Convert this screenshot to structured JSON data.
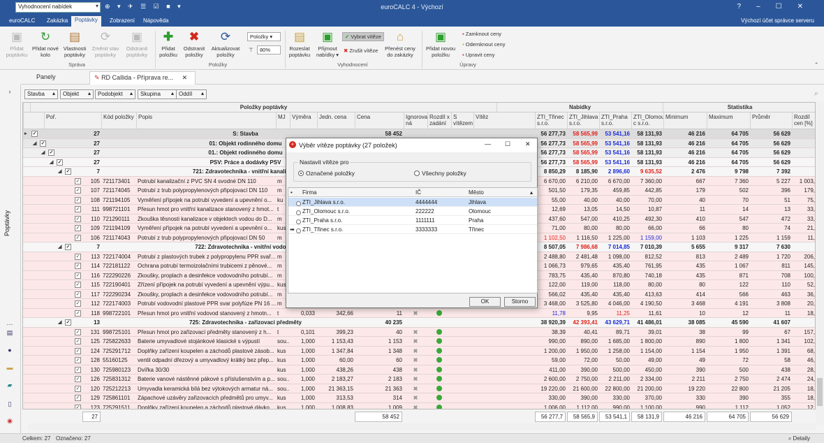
{
  "titlebar": {
    "combo_value": "Vyhodnocení nabídek",
    "title": "euroCALC 4 - Výchozí",
    "help": "?",
    "minimize": "–",
    "maximize": "☐",
    "close": "✕"
  },
  "ribbon_tabs": [
    "euroCALC",
    "Zakázka",
    "Poptávky",
    "Zobrazení",
    "Nápověda"
  ],
  "account": "Výchozí účet správce serveru",
  "ribbon": {
    "sprava": {
      "label": "Správa",
      "buttons": [
        "Přidat poptávku",
        "Přidat nové kolo",
        "Vlastnosti poptávky",
        "Změnit stav poptávky",
        "Odstranit poptávky"
      ]
    },
    "polozky": {
      "label": "Položky",
      "buttons": [
        "Přidat položku",
        "Odstranit položky",
        "Aktualizovat položky"
      ],
      "combo": "Položky",
      "zoom": "80%"
    },
    "vyhodnoceni": {
      "label": "Vyhodnocení",
      "buttons": [
        "Rozeslat poptávku",
        "Přijmout nabídky ▾",
        "Vybrat vítěze",
        "Zrušit vítěze",
        "Přenést ceny do zakázky"
      ]
    },
    "upravy": {
      "label": "Úpravy",
      "buttons": [
        "Přidat novou položku",
        "Zamknout ceny",
        "Odemknout ceny",
        "Upravit ceny"
      ]
    }
  },
  "panels_tab": "Panely",
  "doc_tab": "RD Callida - Příprava re...",
  "sidebar_label": "Poptávky",
  "filters": [
    "Stavba",
    "Objekt",
    "Podobjekt",
    "Skupina",
    "Oddíl"
  ],
  "header_groups": {
    "items": "Položky poptávky",
    "offers": "Nabídky",
    "stats": "Statistika"
  },
  "columns": [
    "Poř.",
    "Kód položky",
    "Popis",
    "MJ",
    "Výměra",
    "Jedn. cena",
    "Cena",
    "Ignorova ná",
    "Rozdíl x zadání",
    "S vítězem",
    "Vítěz",
    "ZTI_Třinec s.r.o.",
    "ZTI_Jihlava s.r.o.",
    "ZTI_Praha s.r.o.",
    "ZTI_Olomou c s.r.o.",
    "Minimum",
    "Maximum",
    "Průměr",
    "Rozdíl cen [%]"
  ],
  "rows": [
    {
      "k": "g0",
      "lvl": 0,
      "por": "27",
      "popis": "S: Stavba",
      "cena": "58 452",
      "t": "56 277,73",
      "j": "58 565,99",
      "p": "53 541,16",
      "o": "58 131,93",
      "min": "46 216",
      "max": "64 705",
      "avg": "56 629",
      "rz": ""
    },
    {
      "k": "g1",
      "lvl": 1,
      "por": "27",
      "popis": "01: Objekt rodinného domu",
      "cena": "",
      "t": "56 277,73",
      "j": "58 565,99",
      "p": "53 541,16",
      "o": "58 131,93",
      "min": "46 216",
      "max": "64 705",
      "avg": "56 629",
      "rz": ""
    },
    {
      "k": "g2",
      "lvl": 2,
      "por": "27",
      "popis": "01.: Objekt rodinného domu",
      "cena": "",
      "t": "56 277,73",
      "j": "58 565,99",
      "p": "53 541,16",
      "o": "58 131,93",
      "min": "46 216",
      "max": "64 705",
      "avg": "56 629",
      "rz": ""
    },
    {
      "k": "g3",
      "lvl": 3,
      "por": "27",
      "popis": "PSV: Práce a dodávky PSV",
      "cena": "",
      "t": "56 277,73",
      "j": "58 565,99",
      "p": "53 541,16",
      "o": "58 131,93",
      "min": "46 216",
      "max": "64 705",
      "avg": "56 629",
      "rz": ""
    },
    {
      "k": "g3",
      "lvl": 4,
      "por": "7",
      "popis": "721: Zdravotechnika - vnitřní kanalizace",
      "cena": "",
      "t": "8 850,29",
      "j": "8 185,90",
      "p": "2 896,60",
      "o": "9 635,52",
      "min": "2 476",
      "max": "9 798",
      "avg": "7 392",
      "rz": ""
    },
    {
      "k": "item",
      "por": "105",
      "kod": "721173401",
      "popis": "Potrubí kanalizační z PVC SN 4 svodné DN 110",
      "mj": "m",
      "t": "6 670,00",
      "j": "6 210,00",
      "p": "6 670,00",
      "o": "7 360,00",
      "min": "667",
      "max": "7 360",
      "avg": "5 227",
      "rz": "1 003,"
    },
    {
      "k": "item",
      "por": "107",
      "kod": "721174045",
      "popis": "Potrubí z trub polypropylenových připojovací DN 110",
      "mj": "m",
      "t": "501,50",
      "j": "179,35",
      "p": "459,85",
      "o": "442,85",
      "min": "179",
      "max": "502",
      "avg": "396",
      "rz": "179,"
    },
    {
      "k": "item",
      "por": "108",
      "kod": "721194105",
      "popis": "Vyměření přípojek na potrubí vyvedení a upevnění o...",
      "mj": "ku",
      "t": "55,00",
      "j": "40,00",
      "p": "40,00",
      "o": "70,00",
      "min": "40",
      "max": "70",
      "avg": "51",
      "rz": "75,"
    },
    {
      "k": "item",
      "por": "111",
      "kod": "998721101",
      "popis": "Přesun hmot pro vnitřní kanalizace stanovený z hmot...",
      "mj": "t",
      "t": "12,69",
      "j": "13,05",
      "p": "14,50",
      "o": "10,87",
      "min": "11",
      "max": "14",
      "avg": "13",
      "rz": "33,"
    },
    {
      "k": "item",
      "por": "110",
      "kod": "721290111",
      "popis": "Zkouška těsnosti kanalizace v objektech vodou do D...",
      "mj": "m",
      "t": "437,60",
      "j": "547,00",
      "p": "410,25",
      "o": "492,30",
      "min": "410",
      "max": "547",
      "avg": "472",
      "rz": "33,"
    },
    {
      "k": "item",
      "por": "109",
      "kod": "721194109",
      "popis": "Vyměření přípojek na potrubí vyvedení a upevnění o...",
      "mj": "kus",
      "t": "71,00",
      "j": "80,00",
      "p": "80,00",
      "o": "66,00",
      "min": "66",
      "max": "80",
      "avg": "74",
      "rz": "21,"
    },
    {
      "k": "item",
      "por": "106",
      "kod": "721174043",
      "popis": "Potrubí z trub polypropylenových připojovací DN 50",
      "mj": "m",
      "t": "1 102,50",
      "j": "1 116,50",
      "p": "1 225,00",
      "o": "1 159,00",
      "min": "1 103",
      "max": "1 225",
      "avg": "1 159",
      "rz": "11,"
    },
    {
      "k": "g3",
      "lvl": 4,
      "por": "7",
      "popis": "722: Zdravotechnika - vnitřní vodovod",
      "cena": "",
      "t": "8 507,05",
      "j": "7 986,68",
      "p": "7 014,85",
      "o": "7 010,39",
      "min": "5 655",
      "max": "9 317",
      "avg": "7 630",
      "rz": ""
    },
    {
      "k": "item",
      "por": "113",
      "kod": "722174004",
      "popis": "Potrubí z plastových trubek z polypropylenu PPR svař...",
      "mj": "m",
      "t": "2 488,80",
      "j": "2 481,48",
      "p": "1 098,00",
      "o": "812,52",
      "min": "813",
      "max": "2 489",
      "avg": "1 720",
      "rz": "206,"
    },
    {
      "k": "item",
      "por": "114",
      "kod": "722181122",
      "popis": "Ochrana potrubí termoizolačními trubicemi z pěnové...",
      "mj": "m",
      "t": "1 066,73",
      "j": "979,65",
      "p": "435,40",
      "o": "761,95",
      "min": "435",
      "max": "1 067",
      "avg": "811",
      "rz": "145,"
    },
    {
      "k": "item",
      "por": "116",
      "kod": "722290226",
      "popis": "Zkoušky, proplach a desinfekce vodovodního potrubí...",
      "mj": "m",
      "t": "783,75",
      "j": "435,40",
      "p": "870,80",
      "o": "740,18",
      "min": "435",
      "max": "871",
      "avg": "708",
      "rz": "100,"
    },
    {
      "k": "item",
      "por": "115",
      "kod": "722190401",
      "popis": "Zřízení přípojek na potrubí vyvedení a upevnění výpu...",
      "mj": "kus",
      "t": "122,00",
      "j": "119,00",
      "p": "118,00",
      "o": "80,00",
      "min": "80",
      "max": "122",
      "avg": "110",
      "rz": "52,"
    },
    {
      "k": "item",
      "por": "117",
      "kod": "722290234",
      "popis": "Zkoušky, proplach a desinfekce vodovodního potrubí...",
      "mj": "m",
      "t": "566,02",
      "j": "435,40",
      "p": "435,40",
      "o": "413,63",
      "min": "414",
      "max": "566",
      "avg": "463",
      "rz": "36,"
    },
    {
      "k": "item",
      "por": "112",
      "kod": "722174003",
      "popis": "Potrubí vodovodní plastové PPR svar polyfúze PN 16 ...",
      "mj": "m",
      "t": "3 468,00",
      "j": "3 525,80",
      "p": "4 046,00",
      "o": "4 190,50",
      "min": "3 468",
      "max": "4 191",
      "avg": "3 808",
      "rz": "20,"
    },
    {
      "k": "item",
      "por": "118",
      "kod": "998722101",
      "popis": "Přesun hmot pro vnitřní vodovod stanovený z hmotn...",
      "mj": "t",
      "vym": "0,033",
      "jc": "342,66",
      "cena": "11",
      "x": "✖",
      "dot": true,
      "t": "11,78",
      "j": "9,95",
      "p": "11,25",
      "o": "11,61",
      "min": "10",
      "max": "12",
      "avg": "11",
      "rz": "18,"
    },
    {
      "k": "g3",
      "lvl": 4,
      "por": "13",
      "popis": "725: Zdravotechnika - zařizovací předměty",
      "cena": "40 235",
      "t": "38 920,39",
      "j": "42 393,41",
      "p": "43 629,71",
      "o": "41 486,01",
      "min": "38 085",
      "max": "45 590",
      "avg": "41 607",
      "rz": ""
    },
    {
      "k": "item",
      "por": "131",
      "kod": "998725101",
      "popis": "Přesun hmot pro zařizovací předměty stanovený z h...",
      "mj": "t",
      "vym": "0,101",
      "jc": "399,23",
      "cena": "40",
      "x": "✖",
      "dot": true,
      "t": "38,39",
      "j": "40,41",
      "p": "89,71",
      "o": "39,01",
      "min": "38",
      "max": "99",
      "avg": "67",
      "rz": "157,"
    },
    {
      "k": "item",
      "por": "125",
      "kod": "725822633",
      "popis": "Baterie umyvadlové stojánkové klasické s výpustí",
      "mj": "sou...",
      "vym": "1,000",
      "jc": "1 153,43",
      "cena": "1 153",
      "x": "✖",
      "dot": true,
      "t": "990,00",
      "j": "890,00",
      "p": "1 685,00",
      "o": "1 800,00",
      "min": "890",
      "max": "1 800",
      "avg": "1 341",
      "rz": "102,"
    },
    {
      "k": "item",
      "por": "124",
      "kod": "725291712",
      "popis": "Doplňky zařízení koupelen a záchodů plastové zásob...",
      "mj": "kus",
      "vym": "1,000",
      "jc": "1 347,84",
      "cena": "1 348",
      "x": "✖",
      "dot": true,
      "t": "1 200,00",
      "j": "1 950,00",
      "p": "1 258,00",
      "o": "1 154,00",
      "min": "1 154",
      "max": "1 950",
      "avg": "1 391",
      "rz": "68,"
    },
    {
      "k": "item",
      "por": "128",
      "kod": "55160125",
      "popis": "ventil odpadní dřezový a umyvadlový krátký bez přep...",
      "mj": "kus",
      "vym": "1,000",
      "jc": "60,00",
      "cena": "60",
      "x": "✖",
      "dot": true,
      "t": "59,00",
      "j": "72,00",
      "p": "50,00",
      "o": "49,00",
      "min": "49",
      "max": "72",
      "avg": "58",
      "rz": "46,"
    },
    {
      "k": "item",
      "por": "130",
      "kod": "725980123",
      "popis": "Dvířka 30/30",
      "mj": "kus",
      "vym": "1,000",
      "jc": "438,26",
      "cena": "438",
      "x": "✖",
      "dot": true,
      "t": "411,00",
      "j": "390,00",
      "p": "500,00",
      "o": "450,00",
      "min": "390",
      "max": "500",
      "avg": "438",
      "rz": "28,"
    },
    {
      "k": "item",
      "por": "126",
      "kod": "725831312",
      "popis": "Baterie vanové nástěnné pákové s příslušenstvím a p...",
      "mj": "sou...",
      "vym": "1,000",
      "jc": "2 183,27",
      "cena": "2 183",
      "x": "✖",
      "dot": true,
      "t": "2 600,00",
      "j": "2 750,00",
      "p": "2 211,00",
      "o": "2 334,00",
      "min": "2 211",
      "max": "2 750",
      "avg": "2 474",
      "rz": "24,"
    },
    {
      "k": "item",
      "por": "120",
      "kod": "725212213",
      "popis": "Umyvadla keramická bílá bez výtokových armatur ná...",
      "mj": "sou...",
      "vym": "1,000",
      "jc": "21 363,15",
      "cena": "21 363",
      "x": "✖",
      "dot": true,
      "t": "19 220,00",
      "j": "21 600,00",
      "p": "22 800,00",
      "o": "21 200,00",
      "min": "19 220",
      "max": "22 800",
      "avg": "21 205",
      "rz": "18,"
    },
    {
      "k": "item",
      "por": "129",
      "kod": "725861101",
      "popis": "Zápachové uzávěry zařizovacích předmětů pro umyv...",
      "mj": "kus",
      "vym": "1,000",
      "jc": "313,53",
      "cena": "314",
      "x": "✖",
      "dot": true,
      "t": "330,00",
      "j": "390,00",
      "p": "330,00",
      "o": "370,00",
      "min": "330",
      "max": "390",
      "avg": "355",
      "rz": "18,"
    },
    {
      "k": "item",
      "por": "123",
      "kod": "725291511",
      "popis": "Doplňky zařízení koupelen a záchodů plastové dávko...",
      "mj": "kus",
      "vym": "1,000",
      "jc": "1 008,83",
      "cena": "1 009",
      "x": "✖",
      "dot": true,
      "t": "1 006,00",
      "j": "1 112,00",
      "p": "990,00",
      "o": "1 100,00",
      "min": "990",
      "max": "1 112",
      "avg": "1 052",
      "rz": "12,"
    }
  ],
  "footer": {
    "count": "27",
    "cena": "58 452",
    "t": "56 277,7",
    "j": "58 565,9",
    "p": "53 541,1",
    "o": "58 131,9",
    "min": "46 216",
    "max": "64 705",
    "avg": "56 629"
  },
  "status": {
    "celkem": "Celkem: 27",
    "oznaceno": "Označeno: 27",
    "detaily": "Detaily"
  },
  "dialog": {
    "title": "Výběr vítěze poptávky (27 položek)",
    "group_label": "Nastavit vítěze pro",
    "radio1": "Označené položky",
    "radio2": "Všechny položky",
    "cols": [
      "Firma",
      "IČ",
      "Město"
    ],
    "rows": [
      {
        "firma": "ZTI_Jihlava s.r.o.",
        "ic": "4444444",
        "mesto": "Jihlava"
      },
      {
        "firma": "ZTI_Olomouc s.r.o.",
        "ic": "222222",
        "mesto": "Olomouc"
      },
      {
        "firma": "ZTI_Praha s.r.o.",
        "ic": "1111111",
        "mesto": "Praha"
      },
      {
        "firma": "ZTI_Třinec s.r.o.",
        "ic": "3333333",
        "mesto": "Třinec"
      }
    ],
    "ok": "OK",
    "cancel": "Storno"
  },
  "colors": {
    "titlebar": "#2b579a",
    "red_value": "#e0201a",
    "blue_value": "#1a2ad6",
    "item_row": "#fce8e8"
  }
}
